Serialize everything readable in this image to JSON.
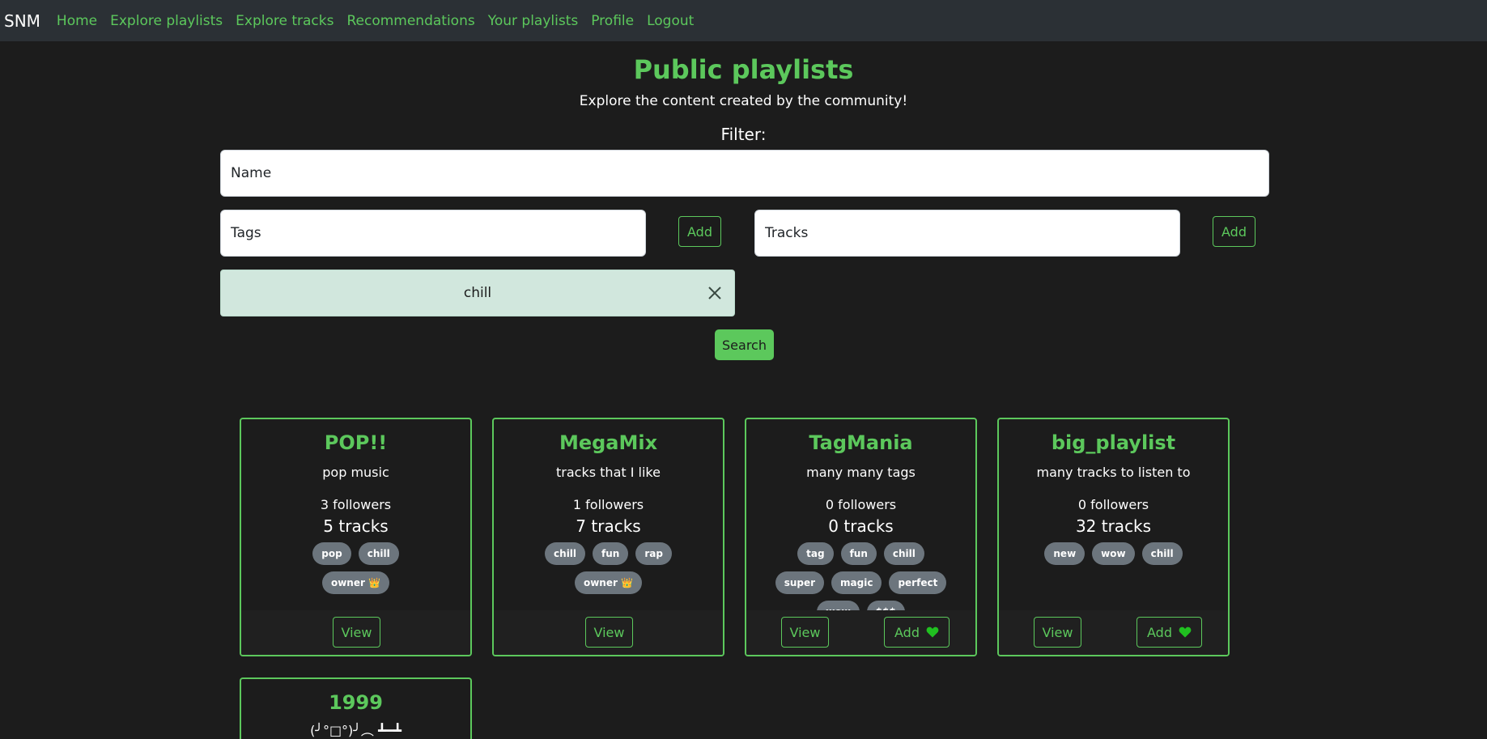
{
  "nav": {
    "brand": "SNM",
    "links": [
      "Home",
      "Explore playlists",
      "Explore tracks",
      "Recommendations",
      "Your playlists",
      "Profile",
      "Logout"
    ]
  },
  "header": {
    "title": "Public playlists",
    "subtitle": "Explore the content created by the community!"
  },
  "filter": {
    "label": "Filter:",
    "name_placeholder": "Name",
    "tags_placeholder": "Tags",
    "tracks_placeholder": "Tracks",
    "add_label": "Add",
    "active_tag": "chill",
    "search_label": "Search"
  },
  "playlists": [
    {
      "name": "POP!!",
      "description": "pop music",
      "followers": "3 followers",
      "tracks": "5 tracks",
      "tags": [
        "pop",
        "chill",
        "owner 👑"
      ],
      "view_label": "View"
    },
    {
      "name": "MegaMix",
      "description": "tracks that I like",
      "followers": "1 followers",
      "tracks": "7 tracks",
      "tags": [
        "chill",
        "fun",
        "rap",
        "owner 👑"
      ],
      "view_label": "View"
    },
    {
      "name": "TagMania",
      "description": "many many tags",
      "followers": "0 followers",
      "tracks": "0 tracks",
      "tags": [
        "tag",
        "fun",
        "chill",
        "super",
        "magic",
        "perfect",
        "wow",
        "$$$"
      ],
      "view_label": "View",
      "add_label": "Add"
    },
    {
      "name": "big_playlist",
      "description": "many tracks to listen to",
      "followers": "0 followers",
      "tracks": "32 tracks",
      "tags": [
        "new",
        "wow",
        "chill"
      ],
      "view_label": "View",
      "add_label": "Add"
    },
    {
      "name": "1999",
      "description": "(╯°□°)╯︵ ┻━┻"
    }
  ],
  "colors": {
    "accent": "#5cc85c",
    "background": "#1c1c1c",
    "navbar": "#2b3035",
    "tag": "#6c757d",
    "chip": "#d1e7dd"
  }
}
